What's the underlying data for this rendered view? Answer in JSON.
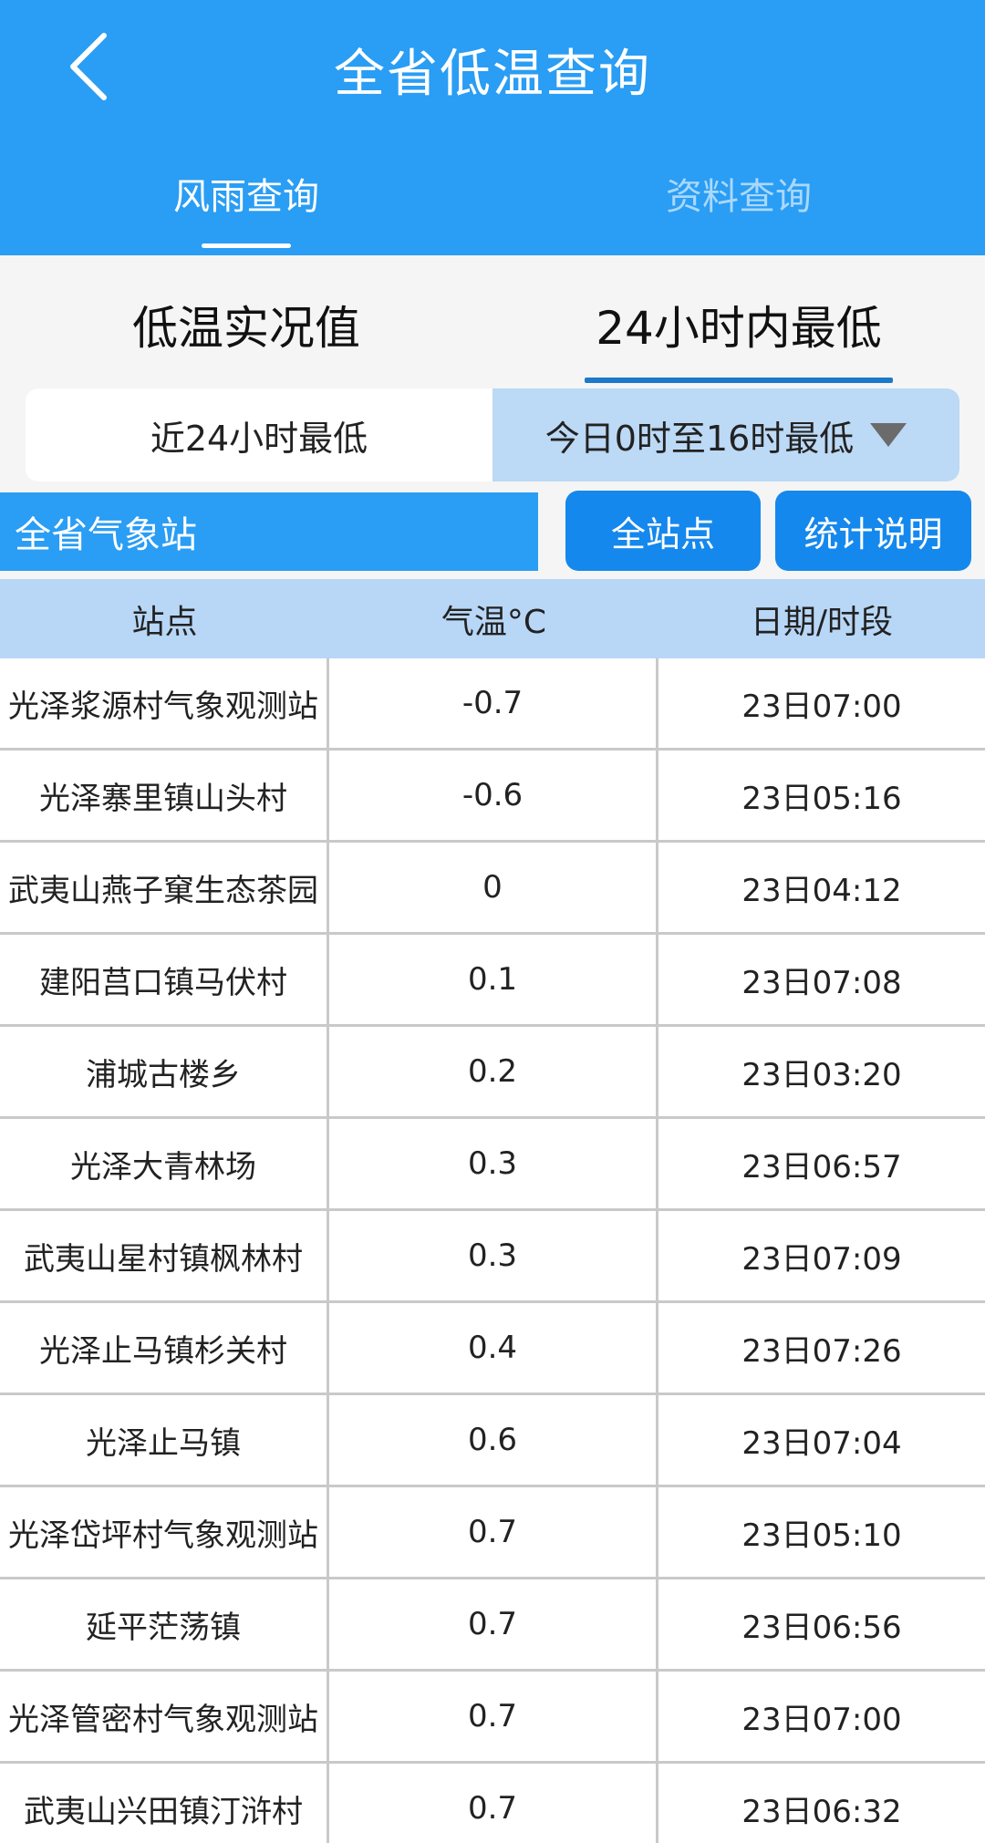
{
  "header": {
    "title": "全省低温查询",
    "tabs": [
      {
        "label": "风雨查询",
        "active": true
      },
      {
        "label": "资料查询",
        "active": false
      }
    ]
  },
  "sub_tabs": [
    {
      "label": "低温实况值",
      "active": false
    },
    {
      "label": "24小时内最低",
      "active": true
    }
  ],
  "segment": {
    "left_label": "近24小时最低",
    "right_label": "今日0时至16时最低"
  },
  "filter": {
    "region_label": "全省气象站",
    "all_stations_label": "全站点",
    "stats_label": "统计说明"
  },
  "table": {
    "headers": [
      "站点",
      "气温°C",
      "日期/时段"
    ],
    "rows": [
      [
        "光泽浆源村气象观测站",
        "-0.7",
        "23日07:00"
      ],
      [
        "光泽寨里镇山头村",
        "-0.6",
        "23日05:16"
      ],
      [
        "武夷山燕子窠生态茶园",
        "0",
        "23日04:12"
      ],
      [
        "建阳莒口镇马伏村",
        "0.1",
        "23日07:08"
      ],
      [
        "浦城古楼乡",
        "0.2",
        "23日03:20"
      ],
      [
        "光泽大青林场",
        "0.3",
        "23日06:57"
      ],
      [
        "武夷山星村镇枫林村",
        "0.3",
        "23日07:09"
      ],
      [
        "光泽止马镇杉关村",
        "0.4",
        "23日07:26"
      ],
      [
        "光泽止马镇",
        "0.6",
        "23日07:04"
      ],
      [
        "光泽岱坪村气象观测站",
        "0.7",
        "23日05:10"
      ],
      [
        "延平茫荡镇",
        "0.7",
        "23日06:56"
      ],
      [
        "光泽管密村气象观测站",
        "0.7",
        "23日07:00"
      ],
      [
        "武夷山兴田镇汀浒村",
        "0.7",
        "23日06:32"
      ]
    ]
  },
  "colors": {
    "primary": "#2a9df4",
    "button": "#1588ed",
    "table_header": "#b8d7f7",
    "segment_selected": "#bcd9f5",
    "sub_tab_underline": "#1d79c9"
  }
}
